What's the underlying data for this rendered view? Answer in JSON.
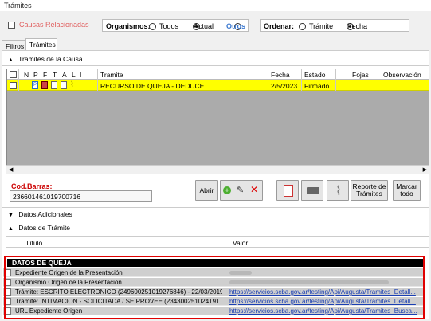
{
  "window": {
    "title": "Trámites"
  },
  "filters": {
    "causas_label": "Causas Relacionadas",
    "organismos_label": "Organismos:",
    "org_options": [
      "Todos",
      "Actual",
      "Otros"
    ],
    "org_selected": "Actual",
    "ordenar_label": "Ordenar:",
    "order_options": [
      "Trámite",
      "Fecha"
    ],
    "order_selected": "Fecha"
  },
  "tabs": [
    "Filtros",
    "Trámites"
  ],
  "active_tab": "Trámites",
  "tramites_section": {
    "title": "Trámites de la Causa",
    "icon_cols": [
      "N",
      "P",
      "F",
      "T",
      "A",
      "L",
      "I"
    ],
    "columns": [
      "Tramite",
      "Fecha",
      "Estado",
      "Fojas",
      "Observación"
    ],
    "rows": [
      {
        "tramite": "RECURSO DE QUEJA - DEDUCE",
        "fecha": "2/5/2023",
        "estado": "Firmado",
        "fojas": "",
        "observacion": ""
      }
    ]
  },
  "barcode": {
    "label": "Cod.Barras:",
    "value": "236601461019700716"
  },
  "toolbar": {
    "abrir": "Abrir",
    "reporte": "Reporte de Trámites",
    "marcar": "Marcar todo"
  },
  "datos_adicionales": {
    "title": "Datos Adicionales"
  },
  "datos_tramite": {
    "title": "Datos de Trámite",
    "columns": [
      "Título",
      "Valor"
    ],
    "group_header": "DATOS DE QUEJA",
    "rows": [
      {
        "titulo": "Expediente Origen de la Presentación",
        "valor": ""
      },
      {
        "titulo": "Organismo Origen de la Presentación",
        "valor": ""
      },
      {
        "titulo": "Trámite: ESCRITO  ELECTRONICO (249600251019276846) - 22/03/2019",
        "valor": "https://servicios.scba.gov.ar/testing/Api/Augusta/Tramites_Detall..."
      },
      {
        "titulo": "Trámite: INTIMACION - SOLICITADA / SE PROVEE (234300251024191…",
        "valor": "https://servicios.scba.gov.ar/testing/Api/Augusta/Tramites_Detall..."
      },
      {
        "titulo": "URL Expediente Origen",
        "valor": "https://servicios.scba.gov.ar/testing/Api/Augusta/Tramites_Busca..."
      }
    ]
  },
  "colors": {
    "selected_row": "#ffff00",
    "causas_red": "#e06060",
    "otros_blue": "#3a78d0",
    "highlight_border": "#e00000",
    "link": "#1a3fb3"
  }
}
